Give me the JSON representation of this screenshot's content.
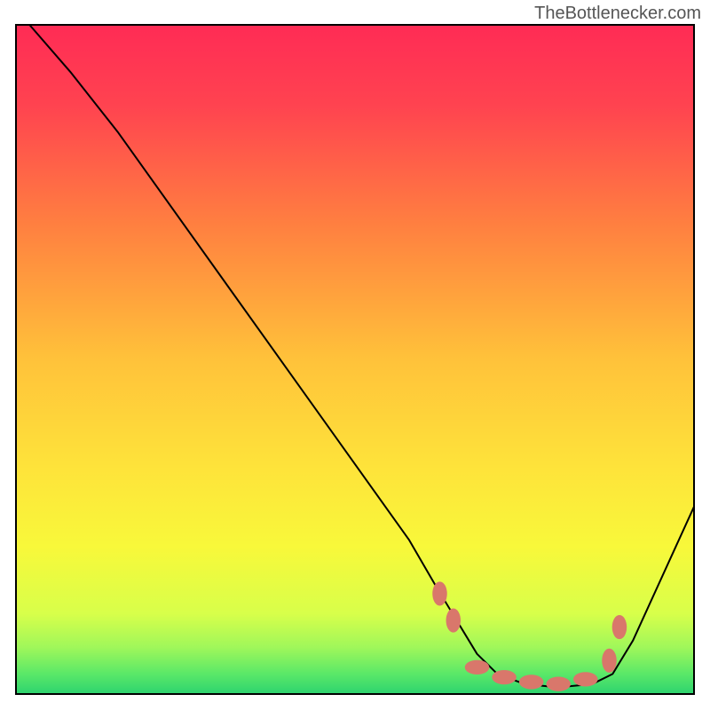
{
  "watermark": "TheBottlenecker.com",
  "chart_data": {
    "type": "line",
    "title": "",
    "xlabel": "",
    "ylabel": "",
    "xlim": [
      0,
      100
    ],
    "ylim": [
      0,
      100
    ],
    "background_gradient": {
      "top_color": "#ff2b55",
      "mid_color": "#fee33a",
      "bottom_color": "#2dd36f"
    },
    "series": [
      {
        "name": "curve",
        "color": "#000000",
        "points": [
          {
            "x": 2,
            "y": 100
          },
          {
            "x": 8,
            "y": 93
          },
          {
            "x": 15,
            "y": 84
          },
          {
            "x": 58,
            "y": 23
          },
          {
            "x": 62,
            "y": 16
          },
          {
            "x": 68,
            "y": 6
          },
          {
            "x": 71,
            "y": 3
          },
          {
            "x": 75,
            "y": 1.5
          },
          {
            "x": 80,
            "y": 1
          },
          {
            "x": 85,
            "y": 1.5
          },
          {
            "x": 88,
            "y": 3
          },
          {
            "x": 91,
            "y": 8
          },
          {
            "x": 100,
            "y": 28
          }
        ]
      }
    ],
    "markers": {
      "color": "#d9776b",
      "shape": "ellipse",
      "points": [
        {
          "x": 62.5,
          "y": 15,
          "rx": 1.2,
          "ry": 2
        },
        {
          "x": 64.5,
          "y": 11,
          "rx": 1.2,
          "ry": 2
        },
        {
          "x": 68,
          "y": 4,
          "rx": 2,
          "ry": 1.2
        },
        {
          "x": 72,
          "y": 2.5,
          "rx": 2,
          "ry": 1.2
        },
        {
          "x": 76,
          "y": 1.8,
          "rx": 2,
          "ry": 1.2
        },
        {
          "x": 80,
          "y": 1.5,
          "rx": 2,
          "ry": 1.2
        },
        {
          "x": 84,
          "y": 2.2,
          "rx": 2,
          "ry": 1.2
        },
        {
          "x": 87.5,
          "y": 5,
          "rx": 1.2,
          "ry": 2
        },
        {
          "x": 89,
          "y": 10,
          "rx": 1.2,
          "ry": 2
        }
      ]
    }
  }
}
